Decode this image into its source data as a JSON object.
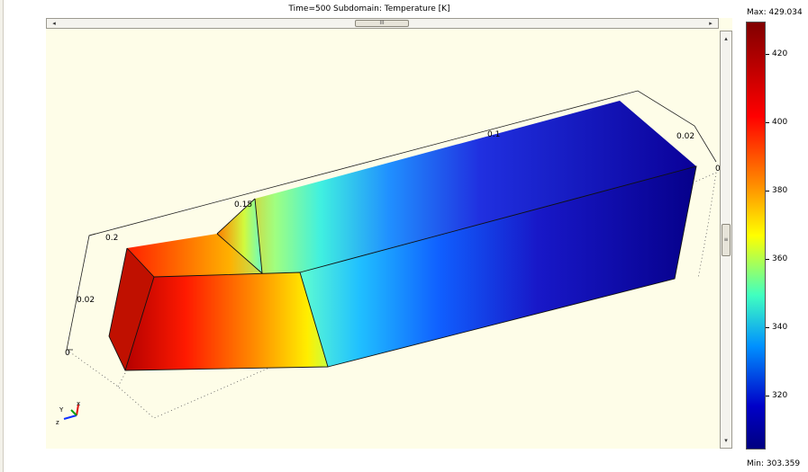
{
  "plot_title": "Time=500    Subdomain: Temperature [K]",
  "colorbar": {
    "max_label": "Max: 429.034",
    "min_label": "Min: 303.359",
    "ticks": [
      "420",
      "400",
      "380",
      "360",
      "340",
      "320"
    ],
    "colors": [
      "#800000",
      "#ff0000",
      "#ff8c00",
      "#ffff00",
      "#40ffc0",
      "#0090ff",
      "#0000c8",
      "#000080"
    ]
  },
  "axes": {
    "labels": [
      "0.02",
      "0.15",
      "0.2",
      "0.02",
      "0",
      "0",
      "0.1"
    ],
    "triad": {
      "x": "x",
      "y": "Y",
      "z": "z"
    }
  },
  "scroll": {
    "grip": "III",
    "left_arrow": "◂",
    "right_arrow": "▸",
    "up_arrow": "▴",
    "down_arrow": "▾"
  }
}
